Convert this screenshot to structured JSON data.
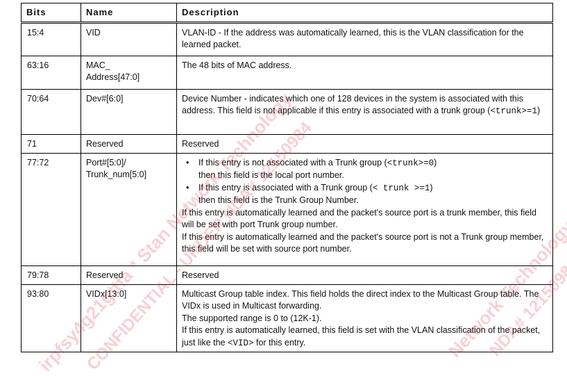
{
  "headers": [
    "Bits",
    "Name",
    "Description"
  ],
  "rows": [
    {
      "bits": "15:4",
      "name": "VID",
      "desc": "VLAN-ID - If the address was automatically learned, this is the VLAN classification for the learned packet."
    },
    {
      "bits": "63:16",
      "name_line1": "MAC_",
      "name_line2": "Address[47:0]",
      "desc": "The 48 bits of MAC address."
    },
    {
      "bits": "70:64",
      "name": "Dev#[6:0]",
      "desc_text": "Device Number - indicates which one of 128 devices in the system is associated with this address. This field is not applicable if this entry is associated with a trunk group (",
      "desc_code": "<trunk>=1",
      "desc_close": ")"
    },
    {
      "bits": "71",
      "name": "Reserved",
      "desc": "Reserved"
    },
    {
      "bits": "77:72",
      "name_line1": "Port#[5:0]/",
      "name_line2": "Trunk_num[5:0]",
      "b1_text": "If this entry is not associated with a Trunk group (",
      "b1_code": "<trunk>=0",
      "b1_close": ")",
      "b1_cont": "then this field is the local port number.",
      "b2_text": "If this entry is associated with a Trunk group (",
      "b2_code": "< trunk >=1",
      "b2_close": ")",
      "b2_cont": "then this field is the Trunk Group Number.",
      "p1": "If this entry is automatically learned and the packet's source port is a trunk member, this field will be set with port Trunk group number.",
      "p2": "If this entry is automatically learned and the packet's source port is not a Trunk group member, this field will be set with source port number."
    },
    {
      "bits": "79:78",
      "name": "Reserved",
      "desc": "Reserved"
    },
    {
      "bits": "93:80",
      "name": "VIDx[13:0]",
      "line1": "Multicast Group table index. This field holds the direct index to the Multicast Group table. The VIDx is used in Multicast forwarding.",
      "line2": "The supported range is 0 to (12K-1).",
      "line3_text": "If this entry is automatically learned, this field is set with the VLAN classification of the packet, just like the ",
      "line3_code": "<VID>",
      "line3_close": " for this entry."
    }
  ],
  "watermarks": [
    "irpfsy4g21gttfa * Stan Network Technology",
    "CONFIDENTIAL - UNDER NDA# 12150984",
    "Network Technology",
    "NDA# 12150984"
  ]
}
